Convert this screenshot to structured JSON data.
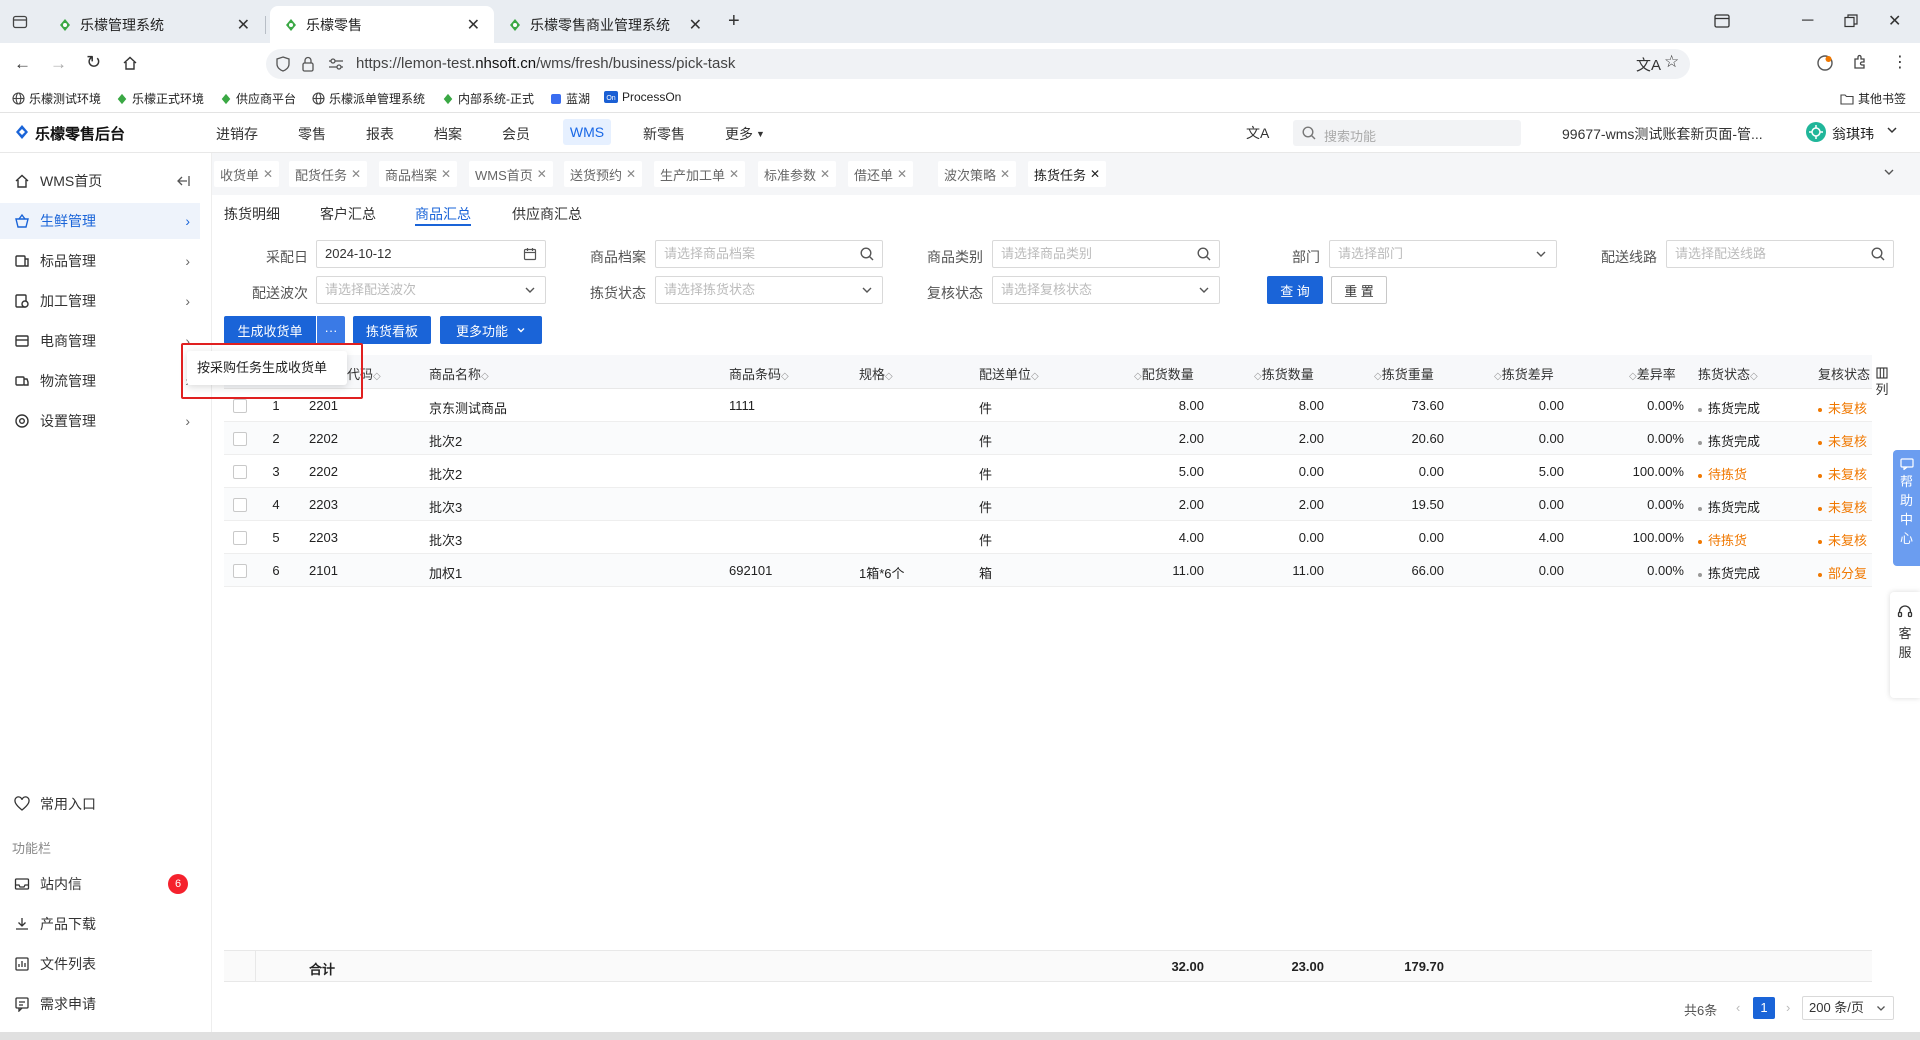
{
  "browser": {
    "tabs": [
      {
        "title": "乐檬管理系统"
      },
      {
        "title": "乐檬零售"
      },
      {
        "title": "乐檬零售商业管理系统"
      }
    ],
    "url_prefix": "https://lemon-test.",
    "url_domain": "nhsoft.cn",
    "url_path": "/wms/fresh/business/pick-task",
    "bookmarks": [
      "乐檬测试环境",
      "乐檬正式环境",
      "供应商平台",
      "乐檬派单管理系统",
      "内部系统-正式",
      "蓝湖",
      "ProcessOn"
    ],
    "other_bookmarks": "其他书签"
  },
  "app": {
    "logo": "乐檬零售后台",
    "nav": [
      "进销存",
      "零售",
      "报表",
      "档案",
      "会员",
      "WMS",
      "新零售",
      "更多"
    ],
    "search_placeholder": "搜索功能",
    "account": "99677-wms测试账套新页面-管...",
    "user": "翁琪玮"
  },
  "sidebar": {
    "items": [
      {
        "label": "WMS首页"
      },
      {
        "label": "生鲜管理"
      },
      {
        "label": "标品管理"
      },
      {
        "label": "加工管理"
      },
      {
        "label": "电商管理"
      },
      {
        "label": "物流管理"
      },
      {
        "label": "设置管理"
      }
    ],
    "common": "常用入口",
    "section": "功能栏",
    "bottom": [
      {
        "label": "站内信",
        "badge": "6"
      },
      {
        "label": "产品下载"
      },
      {
        "label": "文件列表"
      },
      {
        "label": "需求申请"
      }
    ]
  },
  "page_tabs": [
    "收货单",
    "配货任务",
    "商品档案",
    "WMS首页",
    "送货预约",
    "生产加工单",
    "标准参数",
    "借还单",
    "波次策略",
    "拣货任务"
  ],
  "sub_tabs": [
    "拣货明细",
    "客户汇总",
    "商品汇总",
    "供应商汇总"
  ],
  "filters": {
    "date_label": "采配日",
    "date_value": "2024-10-12",
    "product_label": "商品档案",
    "product_placeholder": "请选择商品档案",
    "category_label": "商品类别",
    "category_placeholder": "请选择商品类别",
    "dept_label": "部门",
    "dept_placeholder": "请选择部门",
    "route_label": "配送线路",
    "route_placeholder": "请选择配送线路",
    "wave_label": "配送波次",
    "wave_placeholder": "请选择配送波次",
    "pick_label": "拣货状态",
    "pick_placeholder": "请选择拣货状态",
    "review_label": "复核状态",
    "review_placeholder": "请选择复核状态",
    "query": "查 询",
    "reset": "重 置"
  },
  "actions": {
    "generate": "生成收货单",
    "more_dots": "···",
    "board": "拣货看板",
    "more": "更多功能",
    "popup_item": "按采购任务生成收货单"
  },
  "table": {
    "headers": [
      "代码",
      "商品名称",
      "商品条码",
      "规格",
      "配送单位",
      "配货数量",
      "拣货数量",
      "拣货重量",
      "拣货差异",
      "差异率",
      "拣货状态",
      "复核状态"
    ],
    "col_setting": "列",
    "rows": [
      {
        "idx": "1",
        "code": "2201",
        "name": "京东测试商品",
        "barcode": "1111",
        "spec": "",
        "unit": "件",
        "alloc": "8.00",
        "pick": "8.00",
        "weight": "73.60",
        "diff": "0.00",
        "rate": "0.00%",
        "pick_status": "拣货完成",
        "review": "未复核"
      },
      {
        "idx": "2",
        "code": "2202",
        "name": "批次2",
        "barcode": "",
        "spec": "",
        "unit": "件",
        "alloc": "2.00",
        "pick": "2.00",
        "weight": "20.60",
        "diff": "0.00",
        "rate": "0.00%",
        "pick_status": "拣货完成",
        "review": "未复核"
      },
      {
        "idx": "3",
        "code": "2202",
        "name": "批次2",
        "barcode": "",
        "spec": "",
        "unit": "件",
        "alloc": "5.00",
        "pick": "0.00",
        "weight": "0.00",
        "diff": "5.00",
        "rate": "100.00%",
        "pick_status": "待拣货",
        "review": "未复核"
      },
      {
        "idx": "4",
        "code": "2203",
        "name": "批次3",
        "barcode": "",
        "spec": "",
        "unit": "件",
        "alloc": "2.00",
        "pick": "2.00",
        "weight": "19.50",
        "diff": "0.00",
        "rate": "0.00%",
        "pick_status": "拣货完成",
        "review": "未复核"
      },
      {
        "idx": "5",
        "code": "2203",
        "name": "批次3",
        "barcode": "",
        "spec": "",
        "unit": "件",
        "alloc": "4.00",
        "pick": "0.00",
        "weight": "0.00",
        "diff": "4.00",
        "rate": "100.00%",
        "pick_status": "待拣货",
        "review": "未复核"
      },
      {
        "idx": "6",
        "code": "2101",
        "name": "加权1",
        "barcode": "692101",
        "spec": "1箱*6个",
        "unit": "箱",
        "alloc": "11.00",
        "pick": "11.00",
        "weight": "66.00",
        "diff": "0.00",
        "rate": "0.00%",
        "pick_status": "拣货完成",
        "review": "部分复"
      }
    ],
    "total_label": "合计",
    "total_alloc": "32.00",
    "total_pick": "23.00",
    "total_weight": "179.70"
  },
  "help": "帮助中心",
  "service": "客服",
  "pagination": {
    "total": "共6条",
    "current": "1",
    "size": "200 条/页"
  },
  "colors": {
    "primary": "#1a64d8",
    "warning": "#f07800",
    "help": "#6b9df0"
  }
}
